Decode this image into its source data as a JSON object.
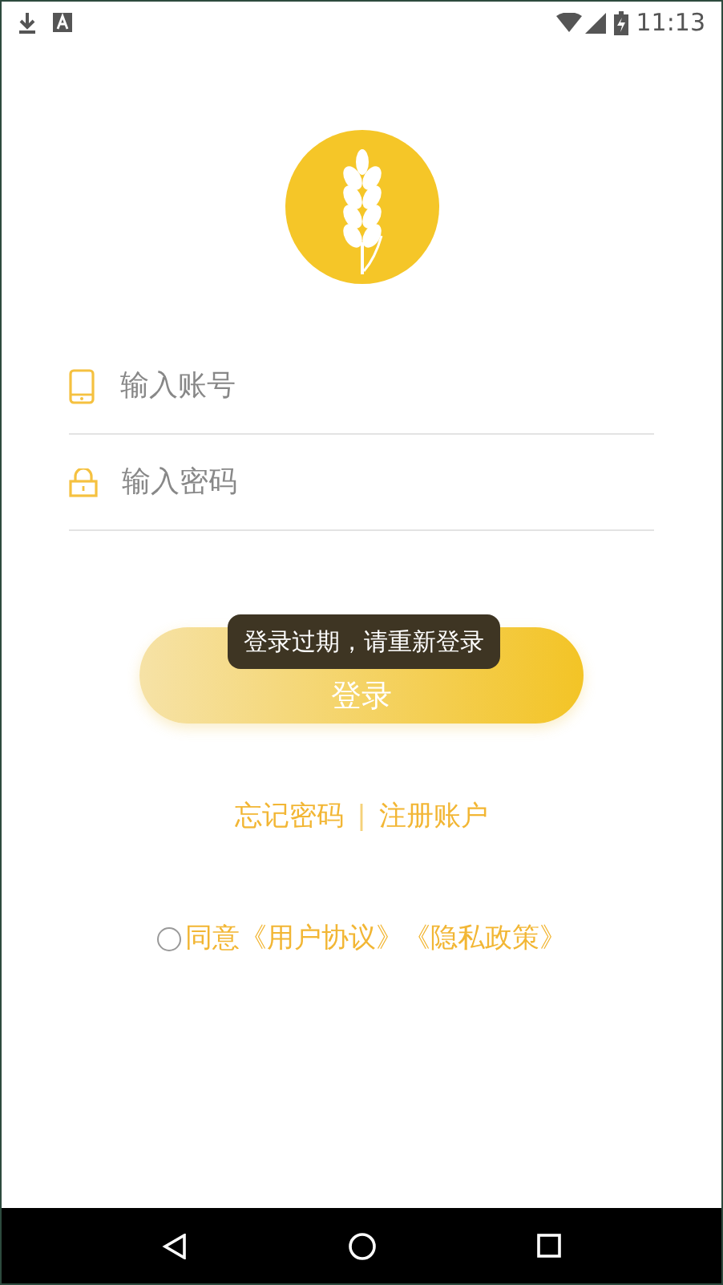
{
  "status_bar": {
    "time": "11:13"
  },
  "form": {
    "account": {
      "placeholder": "输入账号"
    },
    "password": {
      "placeholder": "输入密码"
    }
  },
  "login_button": {
    "label": "登录"
  },
  "toast": {
    "message": "登录过期，请重新登录"
  },
  "links": [
    {
      "label": "忘记密码"
    },
    {
      "label": "注册账户"
    }
  ],
  "links_separator": "|",
  "agreement": {
    "checked": false,
    "prefix": "同意",
    "links": [
      {
        "label": "《用户协议》"
      },
      {
        "label": "《隐私政策》"
      }
    ]
  }
}
